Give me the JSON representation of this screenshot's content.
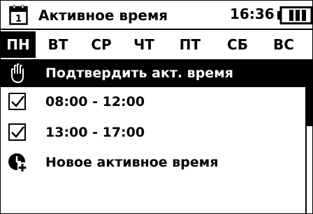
{
  "header": {
    "title": "Активное время",
    "clock": "16:36",
    "calendar_icon": "calendar-icon",
    "calendar_day": "1",
    "battery_icon": "battery-icon"
  },
  "days": [
    {
      "label": "ПН",
      "active": true
    },
    {
      "label": "ВТ",
      "active": false
    },
    {
      "label": "СР",
      "active": false
    },
    {
      "label": "ЧТ",
      "active": false
    },
    {
      "label": "ПТ",
      "active": false
    },
    {
      "label": "СБ",
      "active": false
    },
    {
      "label": "ВС",
      "active": false
    }
  ],
  "items": [
    {
      "label": "Подтвердить акт. время",
      "icon": "hand-icon",
      "selected": true
    },
    {
      "label": "08:00 - 12:00",
      "icon": "checkbox-checked-icon",
      "selected": false
    },
    {
      "label": "13:00 - 17:00",
      "icon": "checkbox-checked-icon",
      "selected": false
    },
    {
      "label": "Новое активное время",
      "icon": "add-clock-icon",
      "selected": false
    }
  ],
  "colors": {
    "foreground": "#000000",
    "background": "#ffffff"
  }
}
